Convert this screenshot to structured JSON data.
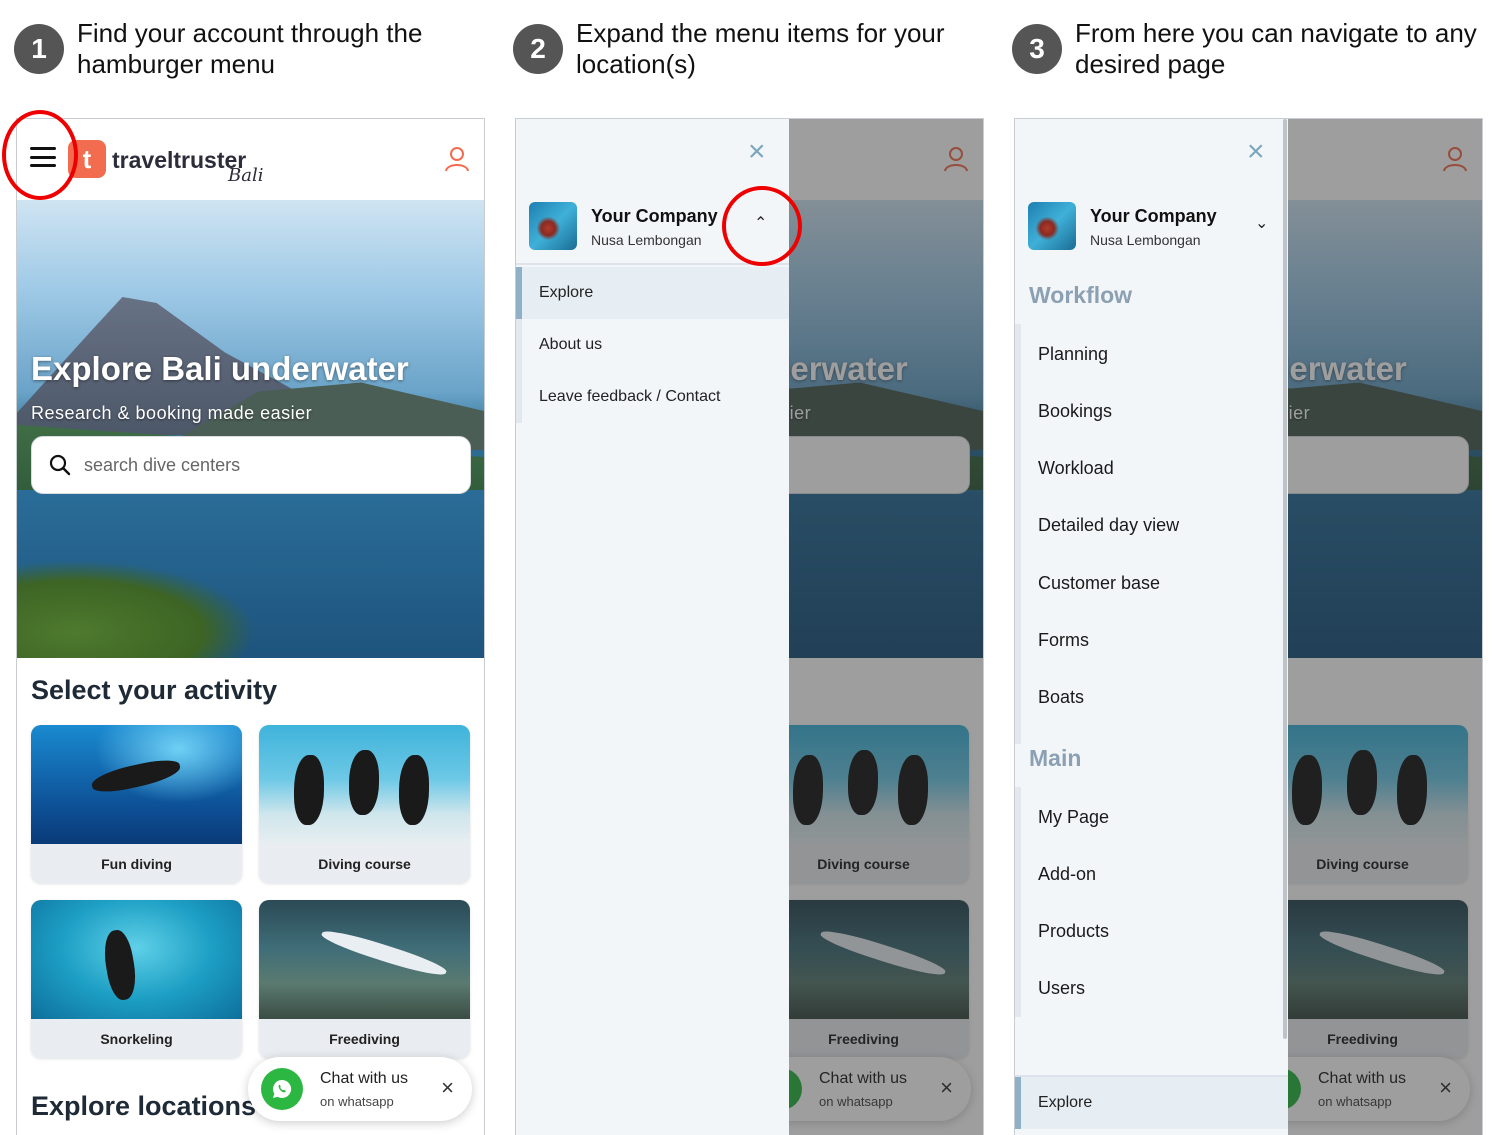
{
  "steps": [
    {
      "num": "1",
      "text": "Find your account through the hamburger menu"
    },
    {
      "num": "2",
      "text": "Expand the menu items for your location(s)"
    },
    {
      "num": "3",
      "text": "From here you can navigate to any desired page"
    }
  ],
  "brand": {
    "name": "traveltruster",
    "sub": "Bali",
    "mark": "t",
    "accent": "#f26d4f"
  },
  "hero": {
    "title": "Explore Bali underwater",
    "subtitle": "Research & booking made easier",
    "search_placeholder": "search dive centers"
  },
  "activity_section": {
    "title": "Select your activity",
    "cards": [
      {
        "label": "Fun diving"
      },
      {
        "label": "Diving course"
      },
      {
        "label": "Snorkeling"
      },
      {
        "label": "Freediving"
      }
    ]
  },
  "locations_section": {
    "title": "Explore locations"
  },
  "chat": {
    "title": "Chat with us",
    "subtitle": "on whatsapp",
    "close": "×"
  },
  "drawer": {
    "close": "×",
    "company": {
      "name": "Your Company",
      "location": "Nusa Lembongan"
    },
    "collapsed_items": [
      "Explore",
      "About us",
      "Leave feedback / Contact"
    ],
    "groups": [
      {
        "title": "Workflow",
        "items": [
          "Planning",
          "Bookings",
          "Workload",
          "Detailed day view",
          "Customer base",
          "Forms",
          "Boats"
        ]
      },
      {
        "title": "Main",
        "items": [
          "My Page",
          "Add-on",
          "Products",
          "Users"
        ]
      }
    ],
    "bottom_item": "Explore"
  },
  "colors": {
    "highlight": "#e00000",
    "step_badge": "#555555",
    "whatsapp": "#2cb742"
  }
}
